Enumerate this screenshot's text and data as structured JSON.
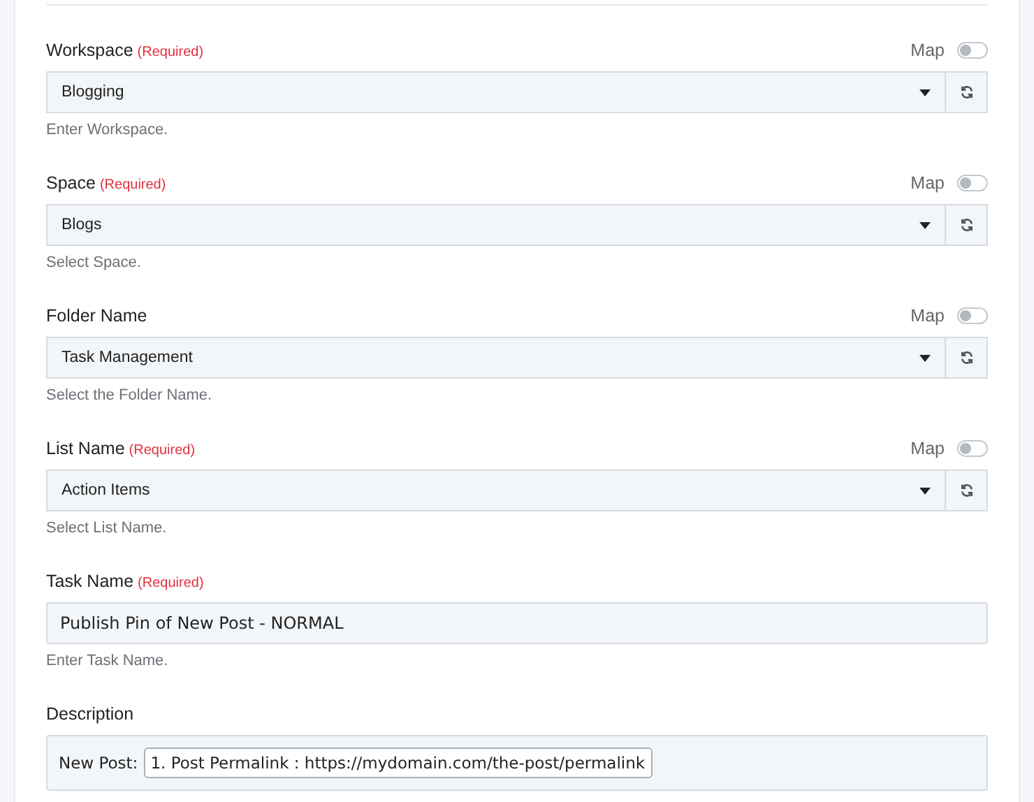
{
  "fields": [
    {
      "kind": "select",
      "label": "Workspace",
      "required_tag": "(Required)",
      "map_label": "Map",
      "map_on": false,
      "value": "Blogging",
      "hint": "Enter Workspace."
    },
    {
      "kind": "select",
      "label": "Space",
      "required_tag": "(Required)",
      "map_label": "Map",
      "map_on": false,
      "value": "Blogs",
      "hint": "Select Space."
    },
    {
      "kind": "select",
      "label": "Folder Name",
      "map_label": "Map",
      "map_on": false,
      "value": "Task Management",
      "hint": "Select the Folder Name."
    },
    {
      "kind": "select",
      "label": "List Name",
      "required_tag": "(Required)",
      "map_label": "Map",
      "map_on": false,
      "value": "Action Items",
      "hint": "Select List Name."
    },
    {
      "kind": "text",
      "label": "Task Name",
      "required_tag": "(Required)",
      "value": "Publish Pin of New Post - NORMAL",
      "hint": "Enter Task Name."
    },
    {
      "kind": "rich",
      "label": "Description",
      "prefix": "New Post:",
      "token": "1. Post Permalink : https://mydomain.com/the-post/permalink"
    }
  ]
}
